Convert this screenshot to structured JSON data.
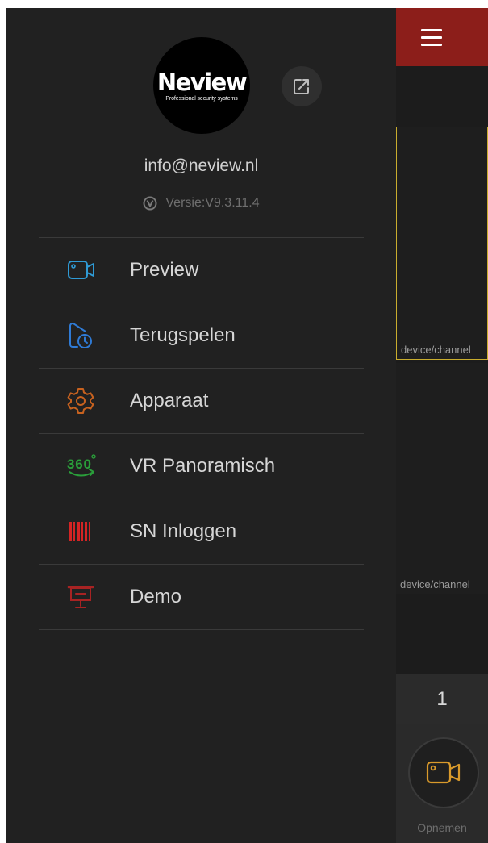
{
  "drawer": {
    "logo": {
      "name": "Neview",
      "tagline": "Professional security systems"
    },
    "account_email": "info@neview.nl",
    "version": "Versie:V9.3.11.4",
    "menu_items": [
      {
        "label": "Preview",
        "icon": "camera-icon",
        "color": "#2f9bd6"
      },
      {
        "label": "Terugspelen",
        "icon": "playback-clock-icon",
        "color": "#2f7bd6"
      },
      {
        "label": "Apparaat",
        "icon": "gear-icon",
        "color": "#c8621f"
      },
      {
        "label": "VR Panoramisch",
        "icon": "vr-360-icon",
        "color": "#2a9e3a"
      },
      {
        "label": "SN Inloggen",
        "icon": "barcode-icon",
        "color": "#d42424"
      },
      {
        "label": "Demo",
        "icon": "presentation-icon",
        "color": "#a82323"
      }
    ]
  },
  "strip": {
    "menu_button_color": "#8c1e1a",
    "channels": [
      {
        "label": "device/channel",
        "selected": true
      },
      {
        "label": "device/channel",
        "selected": false
      }
    ],
    "page_number": "1",
    "record_label": "Opnemen",
    "record_icon_color": "#d99a2b"
  }
}
